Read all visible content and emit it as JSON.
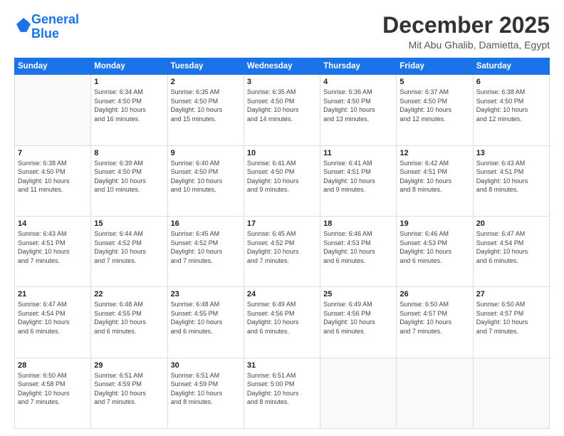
{
  "logo": {
    "line1": "General",
    "line2": "Blue"
  },
  "title": "December 2025",
  "location": "Mit Abu Ghalib, Damietta, Egypt",
  "days_of_week": [
    "Sunday",
    "Monday",
    "Tuesday",
    "Wednesday",
    "Thursday",
    "Friday",
    "Saturday"
  ],
  "weeks": [
    [
      {
        "day": "",
        "info": ""
      },
      {
        "day": "1",
        "info": "Sunrise: 6:34 AM\nSunset: 4:50 PM\nDaylight: 10 hours\nand 16 minutes."
      },
      {
        "day": "2",
        "info": "Sunrise: 6:35 AM\nSunset: 4:50 PM\nDaylight: 10 hours\nand 15 minutes."
      },
      {
        "day": "3",
        "info": "Sunrise: 6:35 AM\nSunset: 4:50 PM\nDaylight: 10 hours\nand 14 minutes."
      },
      {
        "day": "4",
        "info": "Sunrise: 6:36 AM\nSunset: 4:50 PM\nDaylight: 10 hours\nand 13 minutes."
      },
      {
        "day": "5",
        "info": "Sunrise: 6:37 AM\nSunset: 4:50 PM\nDaylight: 10 hours\nand 12 minutes."
      },
      {
        "day": "6",
        "info": "Sunrise: 6:38 AM\nSunset: 4:50 PM\nDaylight: 10 hours\nand 12 minutes."
      }
    ],
    [
      {
        "day": "7",
        "info": "Sunrise: 6:38 AM\nSunset: 4:50 PM\nDaylight: 10 hours\nand 11 minutes."
      },
      {
        "day": "8",
        "info": "Sunrise: 6:39 AM\nSunset: 4:50 PM\nDaylight: 10 hours\nand 10 minutes."
      },
      {
        "day": "9",
        "info": "Sunrise: 6:40 AM\nSunset: 4:50 PM\nDaylight: 10 hours\nand 10 minutes."
      },
      {
        "day": "10",
        "info": "Sunrise: 6:41 AM\nSunset: 4:50 PM\nDaylight: 10 hours\nand 9 minutes."
      },
      {
        "day": "11",
        "info": "Sunrise: 6:41 AM\nSunset: 4:51 PM\nDaylight: 10 hours\nand 9 minutes."
      },
      {
        "day": "12",
        "info": "Sunrise: 6:42 AM\nSunset: 4:51 PM\nDaylight: 10 hours\nand 8 minutes."
      },
      {
        "day": "13",
        "info": "Sunrise: 6:43 AM\nSunset: 4:51 PM\nDaylight: 10 hours\nand 8 minutes."
      }
    ],
    [
      {
        "day": "14",
        "info": "Sunrise: 6:43 AM\nSunset: 4:51 PM\nDaylight: 10 hours\nand 7 minutes."
      },
      {
        "day": "15",
        "info": "Sunrise: 6:44 AM\nSunset: 4:52 PM\nDaylight: 10 hours\nand 7 minutes."
      },
      {
        "day": "16",
        "info": "Sunrise: 6:45 AM\nSunset: 4:52 PM\nDaylight: 10 hours\nand 7 minutes."
      },
      {
        "day": "17",
        "info": "Sunrise: 6:45 AM\nSunset: 4:52 PM\nDaylight: 10 hours\nand 7 minutes."
      },
      {
        "day": "18",
        "info": "Sunrise: 6:46 AM\nSunset: 4:53 PM\nDaylight: 10 hours\nand 6 minutes."
      },
      {
        "day": "19",
        "info": "Sunrise: 6:46 AM\nSunset: 4:53 PM\nDaylight: 10 hours\nand 6 minutes."
      },
      {
        "day": "20",
        "info": "Sunrise: 6:47 AM\nSunset: 4:54 PM\nDaylight: 10 hours\nand 6 minutes."
      }
    ],
    [
      {
        "day": "21",
        "info": "Sunrise: 6:47 AM\nSunset: 4:54 PM\nDaylight: 10 hours\nand 6 minutes."
      },
      {
        "day": "22",
        "info": "Sunrise: 6:48 AM\nSunset: 4:55 PM\nDaylight: 10 hours\nand 6 minutes."
      },
      {
        "day": "23",
        "info": "Sunrise: 6:48 AM\nSunset: 4:55 PM\nDaylight: 10 hours\nand 6 minutes."
      },
      {
        "day": "24",
        "info": "Sunrise: 6:49 AM\nSunset: 4:56 PM\nDaylight: 10 hours\nand 6 minutes."
      },
      {
        "day": "25",
        "info": "Sunrise: 6:49 AM\nSunset: 4:56 PM\nDaylight: 10 hours\nand 6 minutes."
      },
      {
        "day": "26",
        "info": "Sunrise: 6:50 AM\nSunset: 4:57 PM\nDaylight: 10 hours\nand 7 minutes."
      },
      {
        "day": "27",
        "info": "Sunrise: 6:50 AM\nSunset: 4:57 PM\nDaylight: 10 hours\nand 7 minutes."
      }
    ],
    [
      {
        "day": "28",
        "info": "Sunrise: 6:50 AM\nSunset: 4:58 PM\nDaylight: 10 hours\nand 7 minutes."
      },
      {
        "day": "29",
        "info": "Sunrise: 6:51 AM\nSunset: 4:59 PM\nDaylight: 10 hours\nand 7 minutes."
      },
      {
        "day": "30",
        "info": "Sunrise: 6:51 AM\nSunset: 4:59 PM\nDaylight: 10 hours\nand 8 minutes."
      },
      {
        "day": "31",
        "info": "Sunrise: 6:51 AM\nSunset: 5:00 PM\nDaylight: 10 hours\nand 8 minutes."
      },
      {
        "day": "",
        "info": ""
      },
      {
        "day": "",
        "info": ""
      },
      {
        "day": "",
        "info": ""
      }
    ]
  ]
}
